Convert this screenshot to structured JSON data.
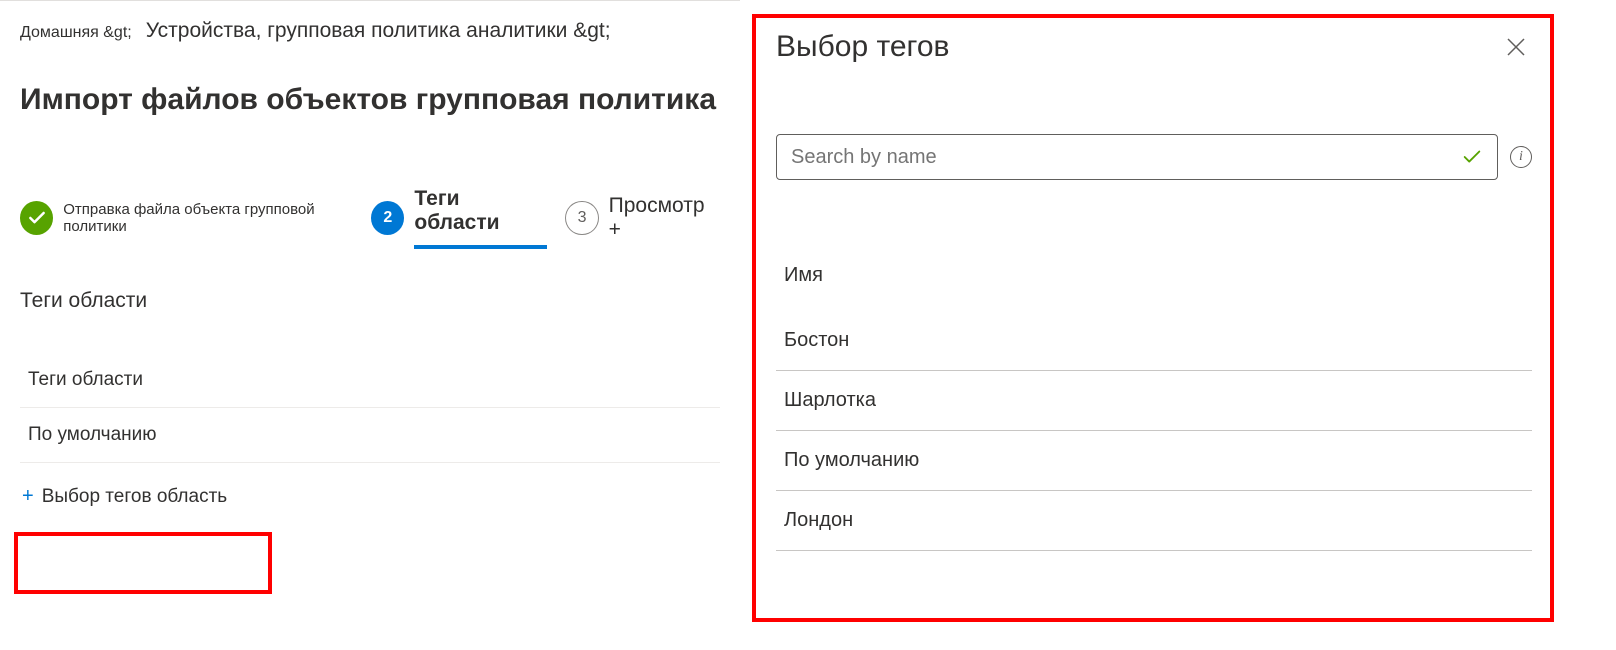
{
  "breadcrumb": {
    "item1": "Домашняя &gt;",
    "item2": "Устройства, групповая политика аналитики &gt;"
  },
  "page_title": "Импорт файлов объектов групповая политика",
  "steps": {
    "step1_label": "Отправка файла объекта групповой политики",
    "step2_label": "Теги области",
    "step2_num": "2",
    "step3_label": "Просмотр +",
    "step3_num": "3"
  },
  "section": {
    "label": "Теги области",
    "table_header": "Теги области",
    "row_default": "По умолчанию",
    "add_link": "Выбор тегов область"
  },
  "panel": {
    "title": "Выбор тегов",
    "search_placeholder": "Search by name",
    "list_header": "Имя",
    "items": [
      "Бостон",
      "Шарлотка",
      "По умолчанию",
      "Лондон"
    ]
  }
}
